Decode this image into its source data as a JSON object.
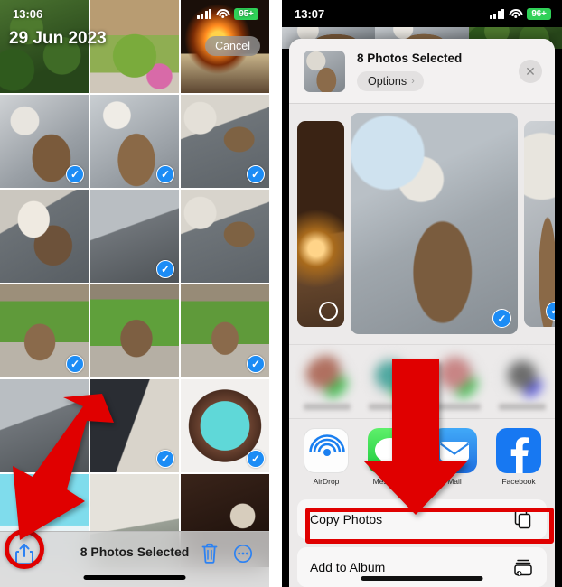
{
  "left_phone": {
    "status_bar": {
      "time": "13:06",
      "signal": "cellular-bars",
      "wifi": "wifi-icon",
      "battery": "95+"
    },
    "date_header": "29 Jun 2023",
    "cancel_label": "Cancel",
    "grid_photos": [
      {
        "id": "p1",
        "scene": "sc-foliage",
        "selected": false
      },
      {
        "id": "p2",
        "scene": "sc-garden",
        "selected": false
      },
      {
        "id": "p3",
        "scene": "sc-fire",
        "selected": false
      },
      {
        "id": "p4",
        "scene": "sc-cat1",
        "selected": true
      },
      {
        "id": "p5",
        "scene": "sc-cat2",
        "selected": true
      },
      {
        "id": "p6",
        "scene": "sc-cat3",
        "selected": true
      },
      {
        "id": "p7",
        "scene": "sc-cat4",
        "selected": false
      },
      {
        "id": "p8",
        "scene": "sc-room",
        "selected": true
      },
      {
        "id": "p9",
        "scene": "sc-cat3",
        "selected": false
      },
      {
        "id": "p10",
        "scene": "sc-dogA",
        "selected": true
      },
      {
        "id": "p11",
        "scene": "sc-dogB",
        "selected": false
      },
      {
        "id": "p12",
        "scene": "sc-dogC",
        "selected": true
      },
      {
        "id": "p13",
        "scene": "sc-room",
        "selected": false
      },
      {
        "id": "p14",
        "scene": "sc-desk",
        "selected": true
      },
      {
        "id": "p15",
        "scene": "sc-dragon",
        "selected": true
      },
      {
        "id": "p16",
        "scene": "sc-wave",
        "selected": false
      },
      {
        "id": "p17",
        "scene": "sc-office",
        "selected": false
      },
      {
        "id": "p18",
        "scene": "sc-portrait",
        "selected": false
      }
    ],
    "toolbar": {
      "share_icon": "share-icon",
      "title": "8 Photos Selected",
      "trash_icon": "trash-icon",
      "more_icon": "more-ellipsis-icon"
    }
  },
  "right_phone": {
    "status_bar": {
      "time": "13:07",
      "signal": "cellular-bars",
      "wifi": "wifi-icon",
      "battery": "96+"
    },
    "share_sheet": {
      "title": "8 Photos Selected",
      "options_label": "Options",
      "options_chevron": "›",
      "close_icon": "close-icon",
      "preview_photos": [
        {
          "id": "s1",
          "scene": "sc-candle",
          "size": "small",
          "selected": false
        },
        {
          "id": "s2",
          "scene": "sc-livingroom",
          "size": "large",
          "selected": true
        },
        {
          "id": "s3",
          "scene": "sc-right3",
          "size": "small",
          "selected": true
        }
      ],
      "contacts": [
        {
          "id": "c1",
          "color1": "#b07060",
          "color2": "#49c05a"
        },
        {
          "id": "c2",
          "color1": "#4fa8a0",
          "color2": "#49c05a"
        },
        {
          "id": "c3",
          "color1": "#c88585",
          "color2": "#49c05a"
        },
        {
          "id": "c4",
          "color1": "#6d6d6d",
          "color2": "#5a5ae0"
        },
        {
          "id": "c5",
          "color1": "#8a8a8a",
          "color2": "#9a9a9a"
        }
      ],
      "apps": [
        {
          "id": "airdrop",
          "label": "AirDrop"
        },
        {
          "id": "messages",
          "label": "Messages"
        },
        {
          "id": "mail",
          "label": "Mail"
        },
        {
          "id": "facebook",
          "label": "Facebook"
        },
        {
          "id": "messenger",
          "label": "Me"
        }
      ],
      "actions": [
        {
          "id": "copy-photos",
          "label": "Copy Photos",
          "icon": "copy-icon",
          "highlighted": true
        },
        {
          "id": "add-to-album",
          "label": "Add to Album",
          "icon": "add-album-icon",
          "highlighted": false
        }
      ]
    }
  },
  "annotations": {
    "accent_color": "#e00000",
    "share_circle": "red-circle-around-share-button",
    "left_arrow": "red-arrow-pointing-to-share-button",
    "right_arrow": "red-arrow-pointing-to-copy-photos",
    "copy_box": "red-box-around-copy-photos-row"
  }
}
